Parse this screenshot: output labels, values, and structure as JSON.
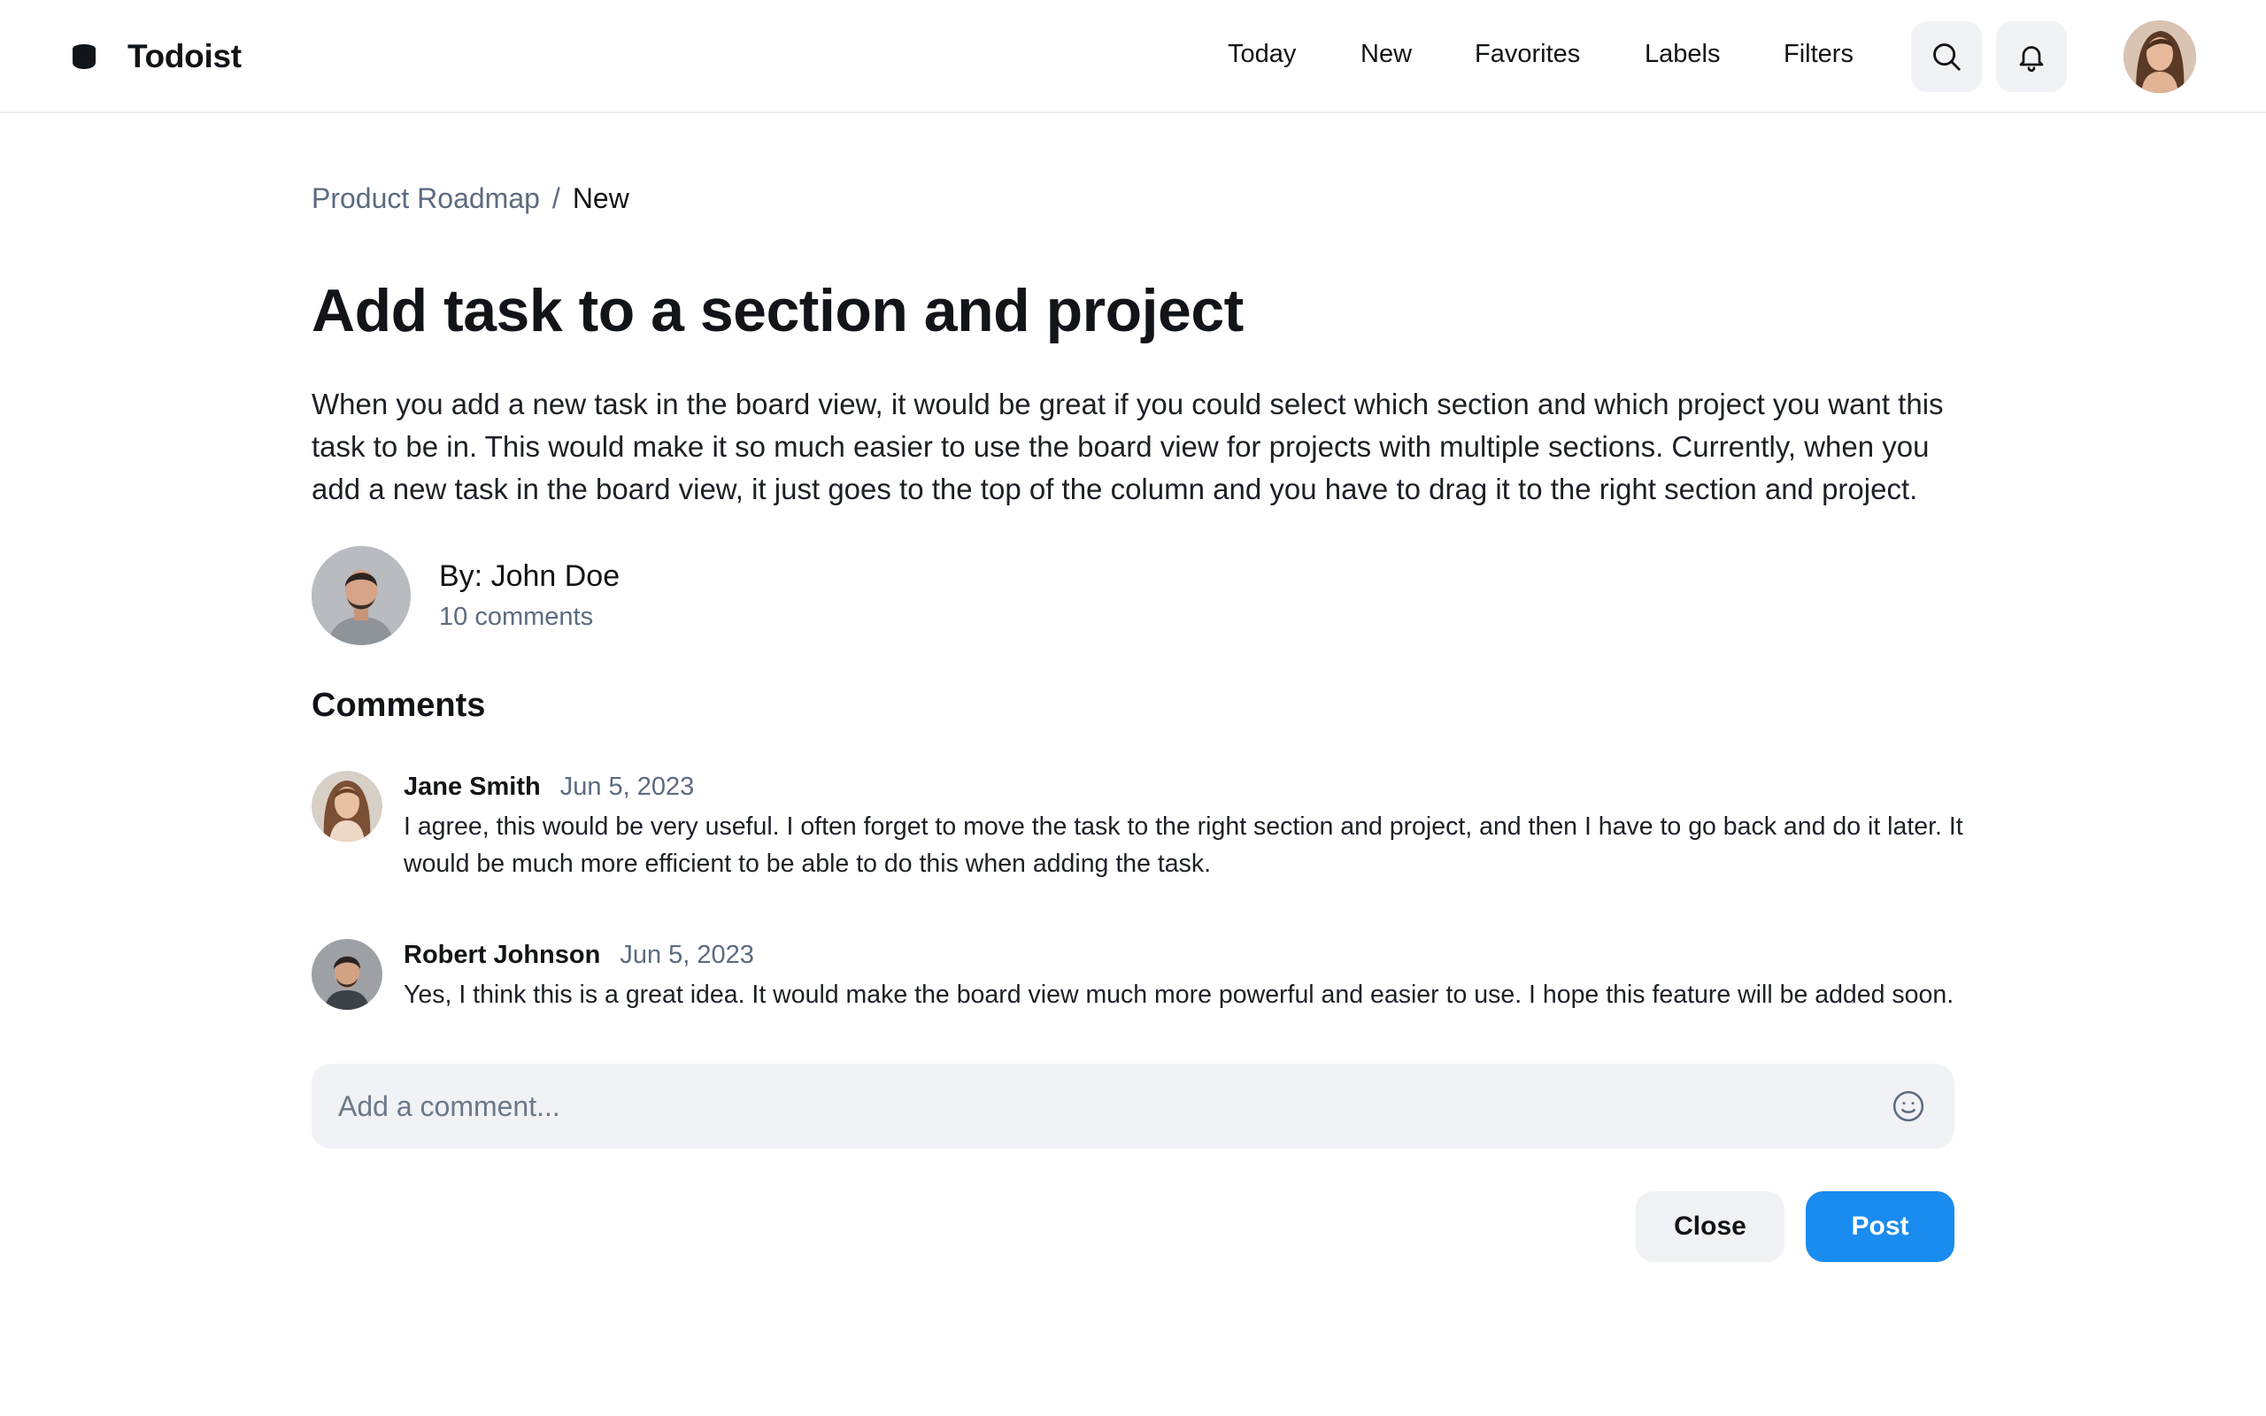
{
  "app": {
    "name": "Todoist",
    "logo_icon": "database-cylinder-icon"
  },
  "nav": {
    "items": [
      {
        "label": "Today"
      },
      {
        "label": "New"
      },
      {
        "label": "Favorites"
      },
      {
        "label": "Labels"
      },
      {
        "label": "Filters"
      }
    ],
    "search_icon": "search-icon",
    "notifications_icon": "bell-icon",
    "user_avatar": "user-avatar"
  },
  "breadcrumb": {
    "parent": "Product Roadmap",
    "separator": "/",
    "current": "New"
  },
  "post": {
    "title": "Add task to a section and project",
    "description": "When you add a new task in the board view, it would be great if you could select which section and which project you want this task to be in. This would make it so much easier to use the board view for projects with multiple sections. Currently, when you add a new task in the board view, it just goes to the top of the column and you have to drag it to the right section and project.",
    "author_line": "By: John Doe",
    "comment_count": "10 comments"
  },
  "comments": {
    "heading": "Comments",
    "items": [
      {
        "author": "Jane Smith",
        "date": "Jun 5, 2023",
        "text": "I agree, this would be very useful. I often forget to move the task to the right section and project, and then I have to go back and do it later. It would be much more efficient to be able to do this when adding the task."
      },
      {
        "author": "Robert Johnson",
        "date": "Jun 5, 2023",
        "text": "Yes, I think this is a great idea. It would make the board view much more powerful and easier to use. I hope this feature will be added soon."
      }
    ]
  },
  "composer": {
    "placeholder": "Add a comment...",
    "value": "",
    "emoji_icon": "smiley-icon",
    "close_label": "Close",
    "post_label": "Post"
  },
  "colors": {
    "accent": "#1a8cf0",
    "muted_text": "#5c6b80",
    "surface": "#f1f2f5"
  }
}
